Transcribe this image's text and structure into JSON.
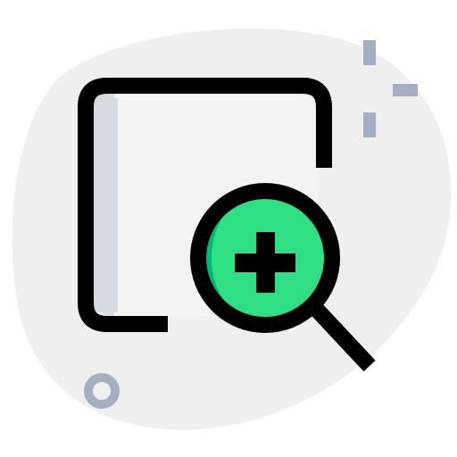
{
  "icon": {
    "name": "zoom-in-square-icon",
    "colors": {
      "blob": "#efefef",
      "square_fill": "#f3f3f1",
      "square_shadow": "#d5dbe1",
      "outline": "#000000",
      "lens_fill": "#2fdf84",
      "lens_shadow": "#00b871",
      "accent": "#a4afc1"
    },
    "parts": [
      "background-blob",
      "square-frame",
      "magnifier-lens",
      "plus-sign",
      "magnifier-handle",
      "sparkle-lines",
      "small-ring"
    ]
  }
}
